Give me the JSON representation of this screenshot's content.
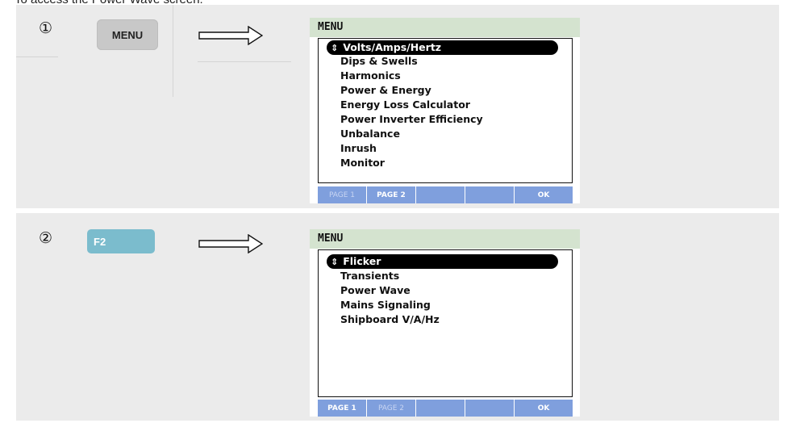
{
  "intro": "To access the Power Wave screen:",
  "steps": [
    {
      "marker": "①",
      "key_label": "MENU",
      "screen": {
        "title": "MENU",
        "items": [
          {
            "label": "Volts/Amps/Hertz",
            "selected": true,
            "icon": "⇕"
          },
          {
            "label": "Dips & Swells"
          },
          {
            "label": "Harmonics"
          },
          {
            "label": "Power & Energy"
          },
          {
            "label": "Energy Loss Calculator"
          },
          {
            "label": "Power Inverter Efficiency"
          },
          {
            "label": "Unbalance"
          },
          {
            "label": "Inrush"
          },
          {
            "label": "Monitor"
          }
        ],
        "softkeys": [
          "PAGE 1",
          "PAGE 2",
          "",
          "",
          "OK"
        ]
      }
    },
    {
      "marker": "②",
      "key_label": "F2",
      "screen": {
        "title": "MENU",
        "items": [
          {
            "label": "Flicker",
            "selected": true,
            "icon": "⇕"
          },
          {
            "label": "Transients"
          },
          {
            "label": "Power Wave"
          },
          {
            "label": "Mains Signaling"
          },
          {
            "label": "Shipboard V/A/Hz"
          }
        ],
        "softkeys": [
          "PAGE 1",
          "PAGE 2",
          "",
          "",
          "OK"
        ]
      }
    }
  ],
  "colors": {
    "panel_bg": "#ebebeb",
    "menu_key_bg": "#c8c8c8",
    "f2_key_bg": "#7bbccd",
    "screen_header_bg": "#d4e3cf",
    "softkey_bar_bg": "#7f9fdd"
  }
}
